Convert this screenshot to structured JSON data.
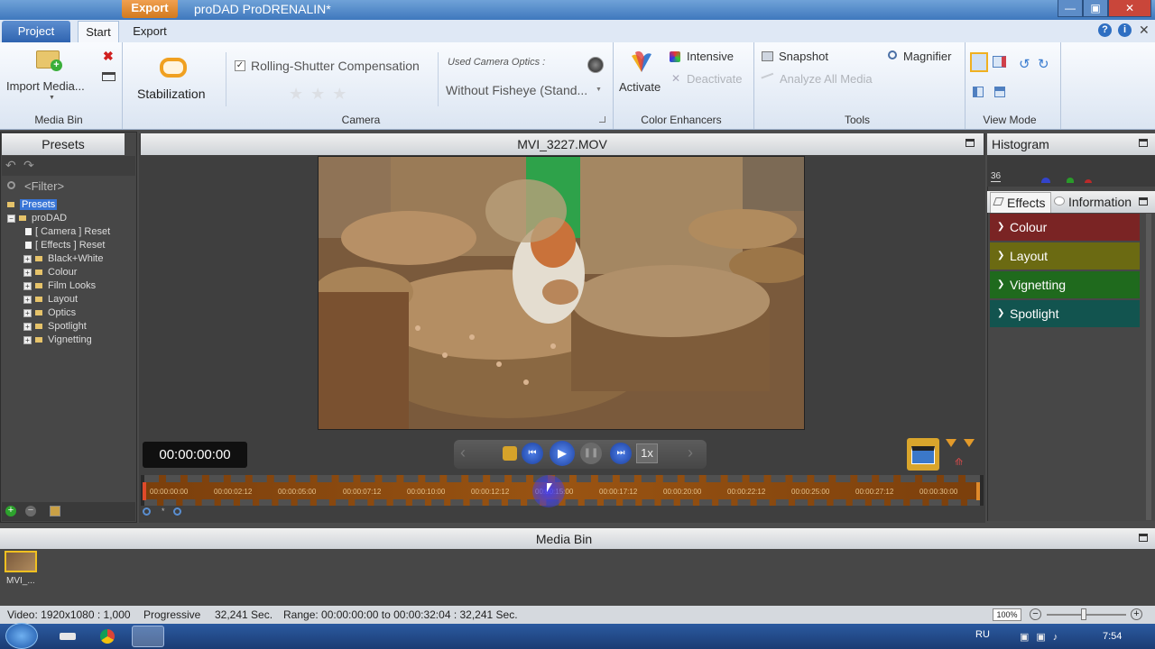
{
  "window": {
    "title": "proDAD ProDRENALIN*",
    "context_tab": "Export",
    "buttons": {
      "minimize": "—",
      "maximize": "▣",
      "close": "✕"
    }
  },
  "tabs": [
    "Project",
    "Start",
    "Export"
  ],
  "ribbon": {
    "media_bin": {
      "import_label": "Import Media...",
      "group_label": "Media Bin"
    },
    "stabilization_label": "Stabilization",
    "camera": {
      "rolling_shutter": "Rolling-Shutter Compensation",
      "rolling_shutter_checked": true,
      "optics_caption": "Used Camera Optics :",
      "optics_value": "Without  Fisheye (Stand...",
      "group_label": "Camera"
    },
    "color_enhancers": {
      "activate": "Activate",
      "intensive": "Intensive",
      "deactivate": "Deactivate",
      "group_label": "Color Enhancers"
    },
    "tools": {
      "snapshot": "Snapshot",
      "magnifier": "Magnifier",
      "analyze": "Analyze All Media",
      "group_label": "Tools"
    },
    "view_mode": {
      "group_label": "View Mode"
    },
    "help_icons": [
      "?",
      "i"
    ]
  },
  "presets": {
    "header": "Presets",
    "filter_placeholder": "<Filter>",
    "root": "Presets",
    "group": "proDAD",
    "resets": [
      {
        "name": "[ Camera ]",
        "action": "Reset"
      },
      {
        "name": "[ Effects ]",
        "action": "Reset"
      }
    ],
    "folders": [
      "Black+White",
      "Colour",
      "Film Looks",
      "Layout",
      "Optics",
      "Spotlight",
      "Vignetting"
    ]
  },
  "viewer": {
    "filename": "MVI_3227.MOV",
    "timecode": "00:00:00:00",
    "speed": "1x",
    "progress": 0
  },
  "timeline": {
    "ticks": [
      "00:00:00:00",
      "00:00:02:12",
      "00:00:05:00",
      "00:00:07:12",
      "00:00:10:00",
      "00:00:12:12",
      "00:00:15:00",
      "00:00:17:12",
      "00:00:20:00",
      "00:00:22:12",
      "00:00:25:00",
      "00:00:27:12",
      "00:00:30:00"
    ]
  },
  "histogram": {
    "header": "Histogram",
    "value": "36"
  },
  "effects": {
    "tabs": [
      "Effects",
      "Information"
    ],
    "items": [
      {
        "label": "Colour",
        "color": "#7a2424"
      },
      {
        "label": "Layout",
        "color": "#6b6a12"
      },
      {
        "label": "Vignetting",
        "color": "#1f6a1d"
      },
      {
        "label": "Spotlight",
        "color": "#12544f"
      }
    ]
  },
  "media_bin": {
    "header": "Media Bin",
    "clip_label": "MVI_..."
  },
  "status": {
    "video": "Video: 1920x1080 : 1,000",
    "scan": "Progressive",
    "duration": "32,241 Sec.",
    "range": "Range: 00:00:00:00 to 00:00:32:04 : 32,241 Sec.",
    "zoom": "100%"
  },
  "taskbar": {
    "lang": "RU",
    "time": "7:54"
  }
}
